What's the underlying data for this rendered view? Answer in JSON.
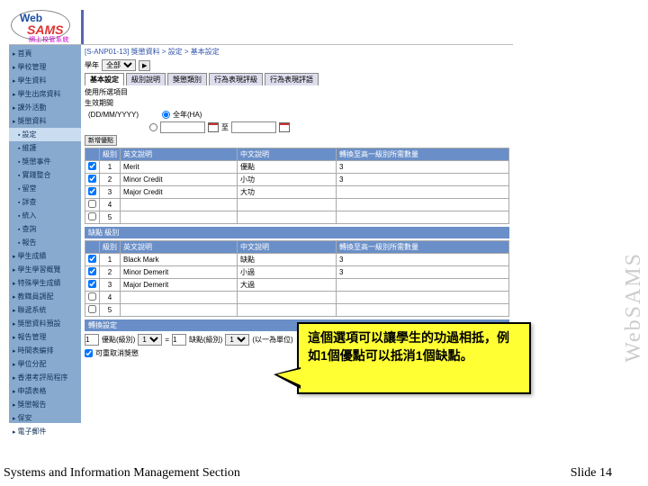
{
  "logo": {
    "web": "Web",
    "sams": "SAMS",
    "cn": "網上校管系統"
  },
  "sidebar": {
    "items": [
      {
        "label": "首頁",
        "sub": false,
        "sel": false,
        "dot": false
      },
      {
        "label": "學校管理",
        "sub": false,
        "sel": false,
        "dot": false
      },
      {
        "label": "學生資料",
        "sub": false,
        "sel": false,
        "dot": false
      },
      {
        "label": "學生出席資料",
        "sub": false,
        "sel": false,
        "dot": false
      },
      {
        "label": "課外活動",
        "sub": false,
        "sel": false,
        "dot": false
      },
      {
        "label": "獎懲資料",
        "sub": false,
        "sel": false,
        "dot": false
      },
      {
        "label": "設定",
        "sub": true,
        "sel": true,
        "dot": true
      },
      {
        "label": "維護",
        "sub": true,
        "sel": false,
        "dot": true
      },
      {
        "label": "獎懲事件",
        "sub": true,
        "sel": false,
        "dot": true
      },
      {
        "label": "實踐整合",
        "sub": true,
        "sel": false,
        "dot": true
      },
      {
        "label": "留堂",
        "sub": true,
        "sel": false,
        "dot": true
      },
      {
        "label": "詳查",
        "sub": true,
        "sel": false,
        "dot": true
      },
      {
        "label": "統入",
        "sub": true,
        "sel": false,
        "dot": true
      },
      {
        "label": "查詢",
        "sub": true,
        "sel": false,
        "dot": true
      },
      {
        "label": "報告",
        "sub": true,
        "sel": false,
        "dot": true
      },
      {
        "label": "學生成績",
        "sub": false,
        "sel": false,
        "dot": false
      },
      {
        "label": "學生學習概覽",
        "sub": false,
        "sel": false,
        "dot": false
      },
      {
        "label": "特殊學生成績",
        "sub": false,
        "sel": false,
        "dot": false
      },
      {
        "label": "教職員調配",
        "sub": false,
        "sel": false,
        "dot": false
      },
      {
        "label": "聯遞系統",
        "sub": false,
        "sel": false,
        "dot": false
      },
      {
        "label": "獎懲資料預設",
        "sub": false,
        "sel": false,
        "dot": false
      },
      {
        "label": "報告管理",
        "sub": false,
        "sel": false,
        "dot": false
      },
      {
        "label": "時間表編排",
        "sub": false,
        "sel": false,
        "dot": false
      },
      {
        "label": "學位分配",
        "sub": false,
        "sel": false,
        "dot": false
      },
      {
        "label": "香港考評局程序",
        "sub": false,
        "sel": false,
        "dot": false
      },
      {
        "label": "申請表格",
        "sub": false,
        "sel": false,
        "dot": false
      },
      {
        "label": "獎懲報告",
        "sub": false,
        "sel": false,
        "dot": false
      },
      {
        "label": "保安",
        "sub": false,
        "sel": false,
        "dot": false
      },
      {
        "label": "電子郵件",
        "sub": false,
        "sel": false,
        "dot": false
      }
    ]
  },
  "crumbs": "[S-ANP01-13] 獎懲資料 > 設定 > 基本設定",
  "filters": {
    "year_label": "學年",
    "year_value": "全部",
    "year_options": [
      "全部"
    ]
  },
  "tabs": [
    "基本設定",
    "級別說明",
    "獎懲類別",
    "行為表現評級",
    "行為表現評語"
  ],
  "tabs_active": 0,
  "use_item": "使用所選項目",
  "date_label": "生效期間",
  "date_hint": "(DD/MM/YYYY)",
  "date_opt1": "全年(HA)",
  "date_opt2": "",
  "date_opt2_to": "至",
  "btn_add_merit": "新增優點",
  "merit_hdr": {
    "h1": "級別",
    "h2": "英文說明",
    "h3": "中文說明",
    "h4": "轉換至高一級別所需數量"
  },
  "merits": [
    {
      "lv": "1",
      "en": "Merit",
      "cn": "優點",
      "num": "3"
    },
    {
      "lv": "2",
      "en": "Minor Credit",
      "cn": "小功",
      "num": "3"
    },
    {
      "lv": "3",
      "en": "Major Credit",
      "cn": "大功",
      "num": ""
    },
    {
      "lv": "4",
      "en": "",
      "cn": "",
      "num": ""
    },
    {
      "lv": "5",
      "en": "",
      "cn": "",
      "num": ""
    }
  ],
  "section_demerit": "缺點 級別",
  "demerit_hdr": {
    "h1": "級別",
    "h2": "英文說明",
    "h3": "中文說明",
    "h4": "轉換至高一級別所需數量"
  },
  "demerits": [
    {
      "lv": "1",
      "en": "Black Mark",
      "cn": "缺點",
      "num": "3"
    },
    {
      "lv": "2",
      "en": "Minor Demerit",
      "cn": "小過",
      "num": "3"
    },
    {
      "lv": "3",
      "en": "Major Demerit",
      "cn": "大過",
      "num": ""
    },
    {
      "lv": "4",
      "en": "",
      "cn": "",
      "num": ""
    },
    {
      "lv": "5",
      "en": "",
      "cn": "",
      "num": ""
    }
  ],
  "section_convert": "轉換設定",
  "convert": {
    "m_lv": "1",
    "m_text": "優點(級別)",
    "eq": "=",
    "d_lv": "1",
    "d_text": "缺點(級別)",
    "note": "(以一為單位)"
  },
  "cancel_chk": "可重取消獎懲",
  "callout": "這個選項可以讓學生的功過相抵，例如1個優點可以抵消1個缺點。",
  "vtext": "WebSAMS",
  "footer_left": "Systems and Information Management Section",
  "footer_right": "Slide 14"
}
